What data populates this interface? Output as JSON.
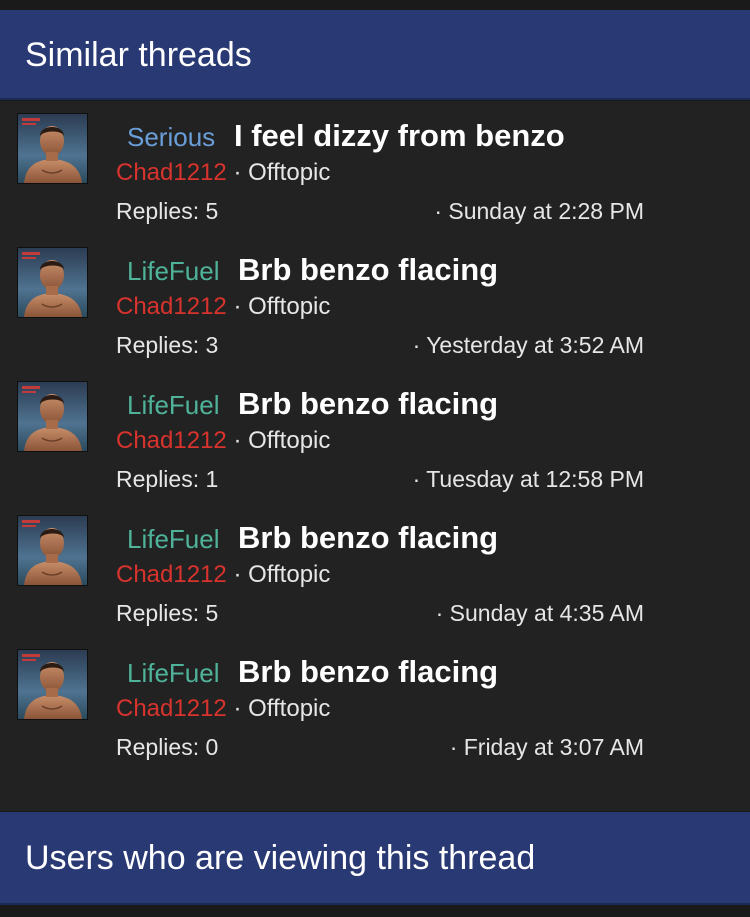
{
  "similar_threads": {
    "title": "Similar threads",
    "threads": [
      {
        "prefix": "Serious",
        "prefix_color": "#6a9ed8",
        "title": "I feel dizzy from benzo",
        "author": "Chad1212",
        "separator": "·",
        "forum": "Offtopic",
        "replies": "Replies: 5",
        "date": "· Sunday at 2:28 PM",
        "avatar_icon": "user-avatar"
      },
      {
        "prefix": "LifeFuel",
        "prefix_color": "#4fb39a",
        "title": "Brb benzo flacing",
        "author": "Chad1212",
        "separator": "·",
        "forum": "Offtopic",
        "replies": "Replies: 3",
        "date": "· Yesterday at 3:52 AM",
        "avatar_icon": "user-avatar"
      },
      {
        "prefix": "LifeFuel",
        "prefix_color": "#4fb39a",
        "title": "Brb benzo flacing",
        "author": "Chad1212",
        "separator": "·",
        "forum": "Offtopic",
        "replies": "Replies: 1",
        "date": "· Tuesday at 12:58 PM",
        "avatar_icon": "user-avatar"
      },
      {
        "prefix": "LifeFuel",
        "prefix_color": "#4fb39a",
        "title": "Brb benzo flacing",
        "author": "Chad1212",
        "separator": "·",
        "forum": "Offtopic",
        "replies": "Replies: 5",
        "date": "· Sunday at 4:35 AM",
        "avatar_icon": "user-avatar"
      },
      {
        "prefix": "LifeFuel",
        "prefix_color": "#4fb39a",
        "title": "Brb benzo flacing",
        "author": "Chad1212",
        "separator": "·",
        "forum": "Offtopic",
        "replies": "Replies: 0",
        "date": "· Friday at 3:07 AM",
        "avatar_icon": "user-avatar"
      }
    ]
  },
  "viewers": {
    "title": "Users who are viewing this thread"
  },
  "colors": {
    "header_bg": "#293973",
    "page_bg": "#1a1a1b",
    "list_bg": "#222223",
    "author": "#d8332c",
    "text": "#e6e6e6"
  }
}
